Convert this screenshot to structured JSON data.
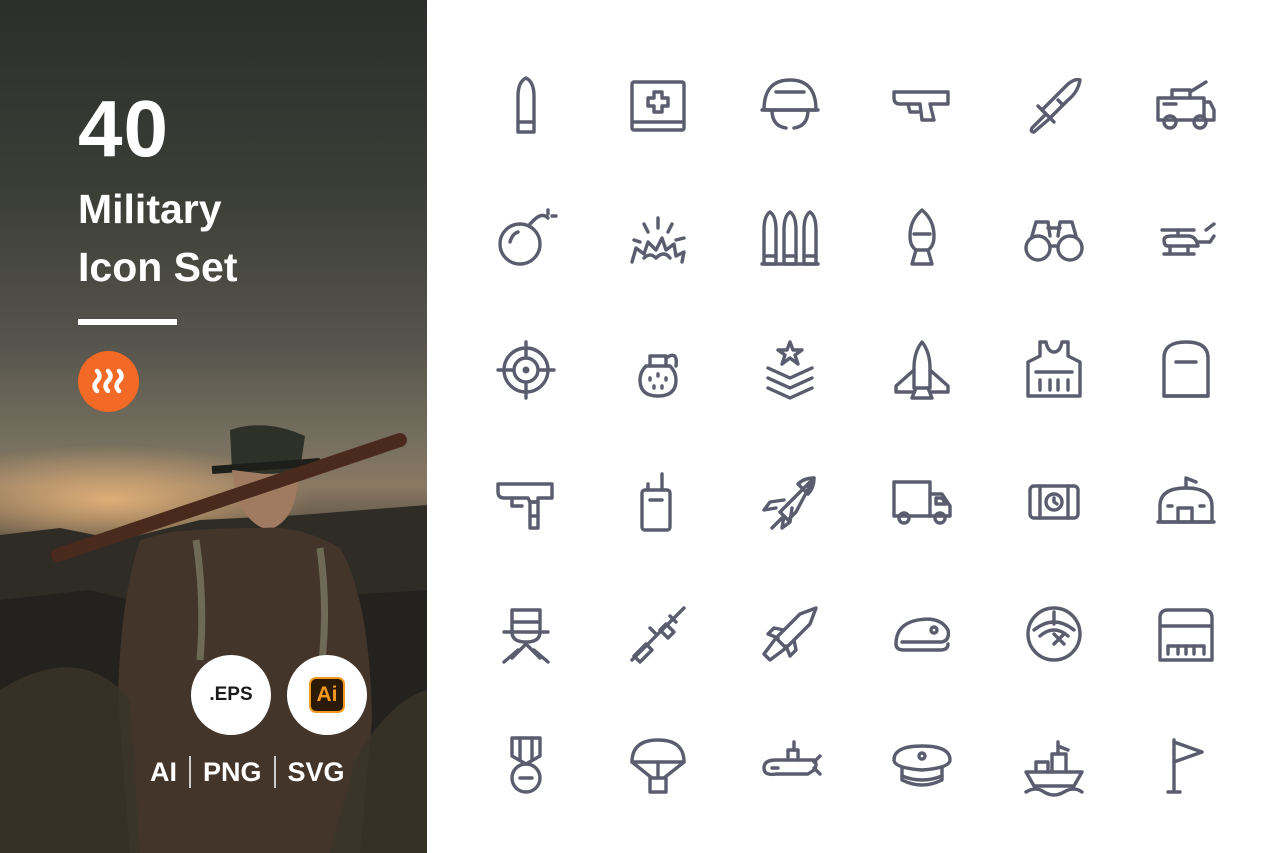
{
  "promo": {
    "count": "40",
    "title_line1": "Military",
    "title_line2": "Icon Set",
    "badges": {
      "eps": ".EPS",
      "ai": "Ai"
    },
    "formats": [
      "AI",
      "PNG",
      "SVG"
    ]
  },
  "colors": {
    "icon": "#5b5c6e",
    "brand": "#f26a25",
    "ai_orange": "#f29a1f",
    "ai_bg": "#2b1a05"
  },
  "icons": [
    "bullet-icon",
    "first-aid-kit-icon",
    "helmet-icon",
    "pistol-icon",
    "combat-knife-icon",
    "armored-truck-icon",
    "bomb-icon",
    "explosion-icon",
    "ammunition-icon",
    "mortar-shell-icon",
    "binoculars-icon",
    "helicopter-icon",
    "crosshair-icon",
    "grenade-icon",
    "rank-insignia-icon",
    "fighter-jet-icon",
    "bulletproof-vest-icon",
    "tombstone-icon",
    "submachine-gun-icon",
    "walkie-talkie-icon",
    "rocket-icon",
    "military-truck-icon",
    "dynamite-icon",
    "bunker-icon",
    "soldier-icon",
    "sniper-rifle-icon",
    "missile-icon",
    "beret-icon",
    "radar-icon",
    "barracks-icon",
    "medal-icon",
    "parachute-icon",
    "submarine-icon",
    "officer-cap-icon",
    "warship-icon",
    "flag-icon"
  ]
}
